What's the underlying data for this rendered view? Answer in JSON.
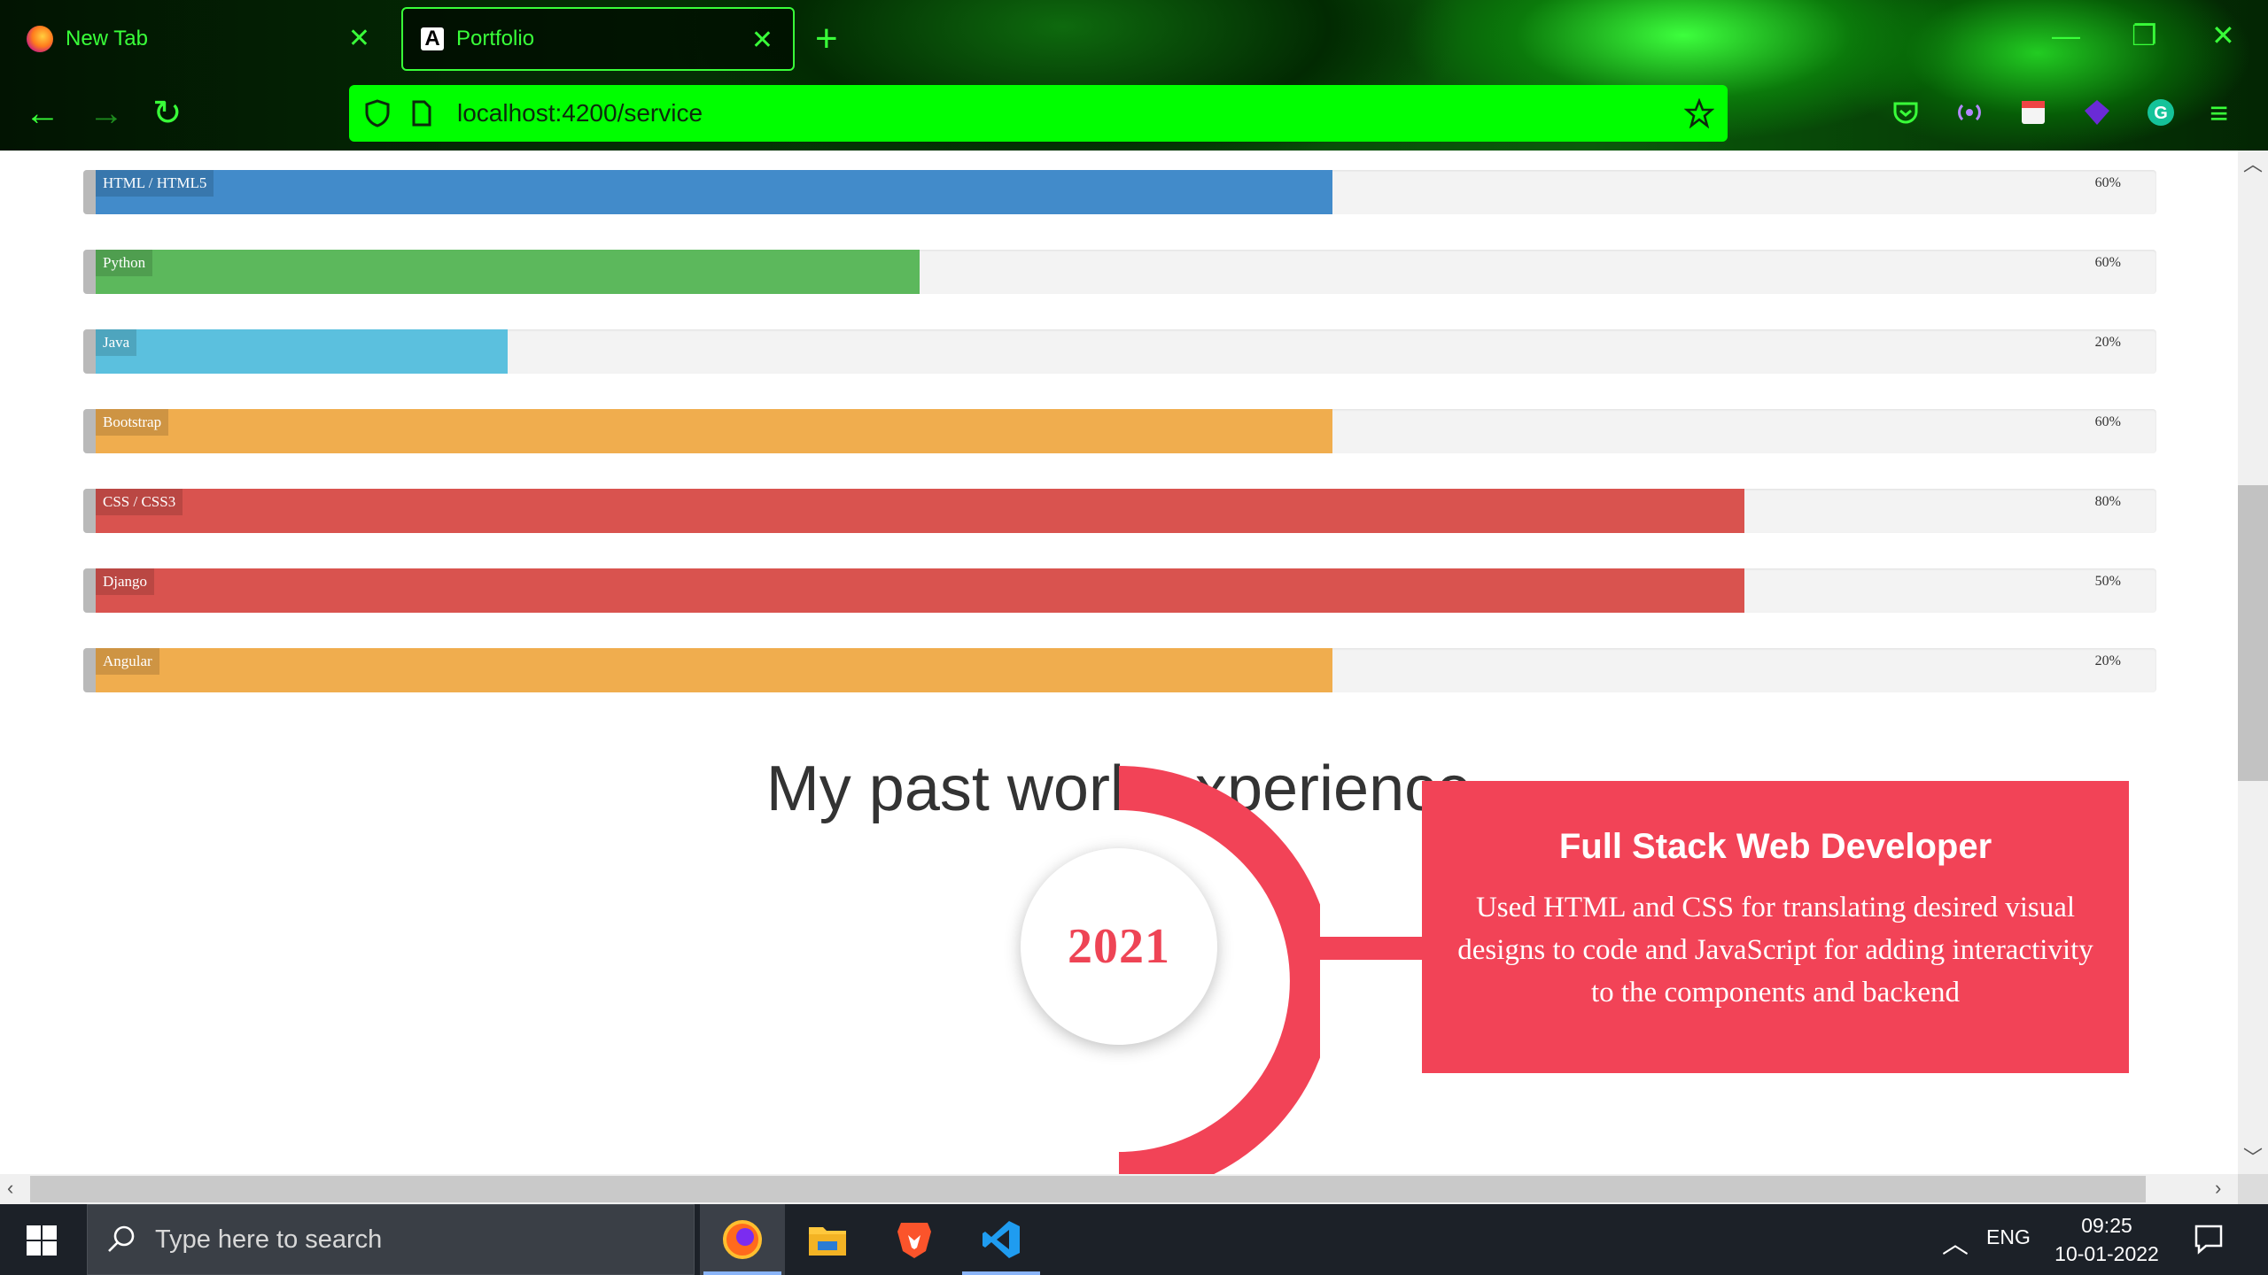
{
  "browser": {
    "tabs": [
      {
        "label": "New Tab",
        "active": false
      },
      {
        "label": "Portfolio",
        "active": true
      }
    ],
    "url": "localhost:4200/service",
    "accent": "#39ff39",
    "urlbar_color": "#00ff00"
  },
  "skills": [
    {
      "label": "HTML / HTML5",
      "percent_text": "60%",
      "fill_fraction": 0.6,
      "color": "#428bca"
    },
    {
      "label": "Python",
      "percent_text": "60%",
      "fill_fraction": 0.4,
      "color": "#5cb85c"
    },
    {
      "label": "Java",
      "percent_text": "20%",
      "fill_fraction": 0.2,
      "color": "#5bc0de"
    },
    {
      "label": "Bootstrap",
      "percent_text": "60%",
      "fill_fraction": 0.6,
      "color": "#f0ad4e"
    },
    {
      "label": "CSS / CSS3",
      "percent_text": "80%",
      "fill_fraction": 0.8,
      "color": "#d9534f"
    },
    {
      "label": "Django",
      "percent_text": "50%",
      "fill_fraction": 0.8,
      "color": "#d9534f"
    },
    {
      "label": "Angular",
      "percent_text": "20%",
      "fill_fraction": 0.6,
      "color": "#f0ad4e"
    }
  ],
  "experience": {
    "heading": "My past work experience",
    "year": "2021",
    "job_title": "Full Stack Web Developer",
    "job_description": "Used HTML and CSS for translating desired visual designs to code and JavaScript for adding interactivity to the components and backend",
    "accent": "#f24357"
  },
  "taskbar": {
    "search_placeholder": "Type here to search",
    "apps": [
      "firefox-icon",
      "file-explorer-icon",
      "brave-icon",
      "vscode-icon"
    ],
    "language": "ENG",
    "time": "09:25",
    "date": "10-01-2022"
  }
}
